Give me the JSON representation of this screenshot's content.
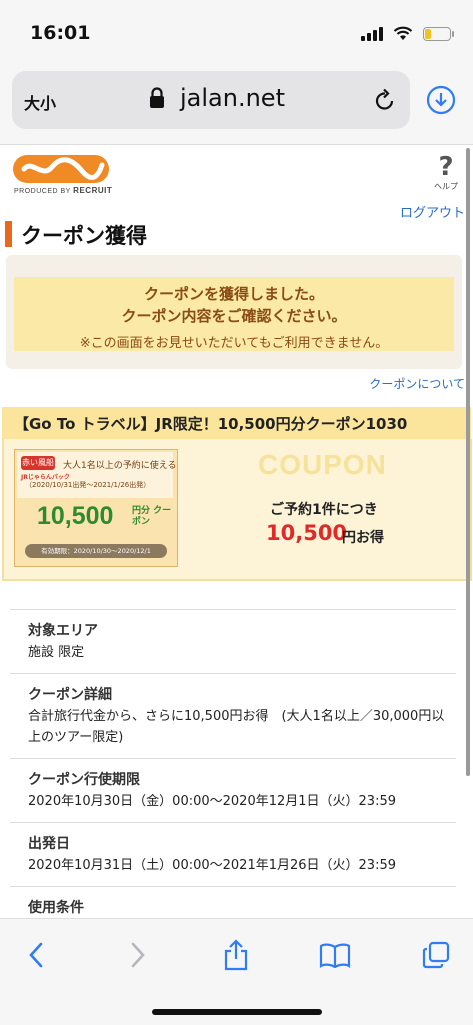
{
  "status": {
    "time": "16:01"
  },
  "browser": {
    "text_size": "大小",
    "url": "jalan.net"
  },
  "header": {
    "produced_by": "PRODUCED BY",
    "recruit": "RECRUIT",
    "help": "ヘルプ",
    "help_mark": "?",
    "logout": "ログアウト"
  },
  "page": {
    "title": "クーポン獲得",
    "message_line1": "クーポンを獲得しました。",
    "message_line2": "クーポン内容をご確認ください。",
    "message_note": "※この画面をお見せいただいてもご利用できません。",
    "coupon_about": "クーポンについて"
  },
  "coupon": {
    "headline": "【Go To トラベル】JR限定！10,500円分クーポン1030",
    "ticket": {
      "badge": "赤い風船",
      "pack": "JRじゃらんパック",
      "condition": "大人1名以上の予約に使える",
      "dates": "（2020/10/31出発〜2021/1/26出発）",
      "amount": "10,500",
      "unit": "円分 クーポン",
      "validity": "有効期限：2020/10/30〜2020/12/1"
    },
    "watermark": "COUPON",
    "per_booking": "ご予約1件につき",
    "benefit_amount": "10,500",
    "benefit_unit": "円お得"
  },
  "details": [
    {
      "label": "対象エリア",
      "value": "施設 限定"
    },
    {
      "label": "クーポン詳細",
      "value": "合計旅行代金から、さらに10,500円お得　(大人1名以上／30,000円以上のツアー限定)"
    },
    {
      "label": "クーポン行使期限",
      "value": "2020年10月30日（金）00:00〜2020年12月1日（火）23:59"
    },
    {
      "label": "出発日",
      "value": "2020年10月31日（土）00:00〜2021年1月26日（火）23:59"
    },
    {
      "label": "使用条件",
      "value": ""
    }
  ],
  "colors": {
    "accent": "#e8691c",
    "link": "#2a6cc7",
    "ios_blue": "#2f7cf6",
    "highlight": "#fbe49b"
  }
}
